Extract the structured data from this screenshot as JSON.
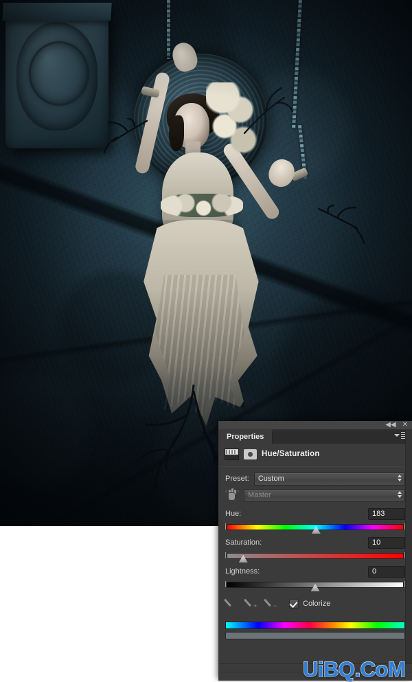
{
  "document": {
    "photo_alt": "dark gothic composite photo of a woman with raised arms against a cracked stone wall"
  },
  "panel": {
    "topbar": {
      "collapse_icon": "collapse-to-icons",
      "collapse_glyph": "◀◀",
      "close_icon": "close-panel",
      "close_glyph": "✕"
    },
    "tab": "Properties",
    "menu_icon": "panel-menu-icon",
    "header": {
      "icon_left": "histogram-icon",
      "icon_right": "adjustment-circle-icon",
      "title": "Hue/Saturation"
    },
    "preset": {
      "label": "Preset:",
      "value": "Custom"
    },
    "channel": {
      "targeted_adjust_icon": "on-image-adjustment-hand-icon",
      "value": "Master"
    },
    "sliders": [
      {
        "label": "Hue:",
        "value": "183",
        "numeric": 183,
        "min": -180,
        "max": 180,
        "thumb_percent": 50.5,
        "track": "hue-rainbow"
      },
      {
        "label": "Saturation:",
        "value": "10",
        "numeric": 10,
        "min": -100,
        "max": 100,
        "thumb_percent": 10,
        "track": "gray-to-red"
      },
      {
        "label": "Lightness:",
        "value": "0",
        "numeric": 0,
        "min": -100,
        "max": 100,
        "thumb_percent": 50,
        "track": "black-to-white"
      }
    ],
    "eyedroppers": [
      {
        "name": "eyedropper-sample",
        "sign": ""
      },
      {
        "name": "eyedropper-add",
        "sign": "+"
      },
      {
        "name": "eyedropper-subtract",
        "sign": "−"
      }
    ],
    "colorize": {
      "label": "Colorize",
      "checked": true
    },
    "colorize_bar": "colorize-spectrum",
    "range_bar": "hue-range-bar"
  },
  "watermark": {
    "text": "UiBQ.CoM",
    "color": "#2f7fd6"
  },
  "colors": {
    "panel_bg": "#3b3b3b",
    "panel_tabbar": "#2f2f2f",
    "input_bg": "#2b2b2b",
    "text": "#d6d6d6",
    "watermark": "#2f7fd6"
  }
}
